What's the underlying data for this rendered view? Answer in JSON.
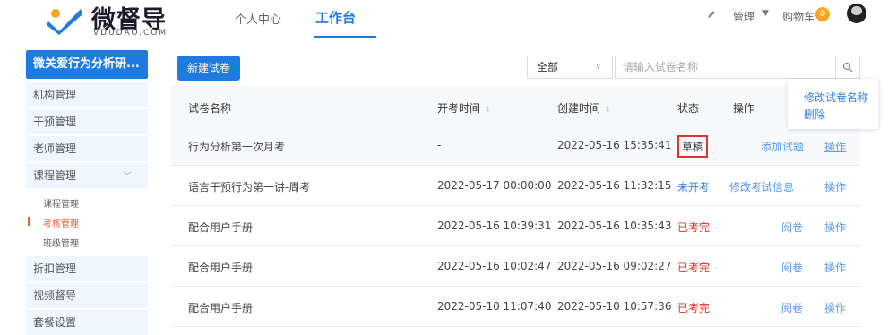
{
  "brand": {
    "name": "微督导",
    "sub": "VDUDAO.COM"
  },
  "nav": {
    "personal": "个人中心",
    "workbench": "工作台"
  },
  "header_right": {
    "manage": "管理",
    "cart": "购物车",
    "cart_count": "0"
  },
  "sidebar": {
    "org": "微关爱行为分析研...",
    "items": [
      "机构管理",
      "干预管理",
      "老师管理",
      "课程管理"
    ],
    "subitems": [
      "课程管理",
      "考核管理",
      "班级管理"
    ],
    "items2": [
      "折扣管理",
      "视频督导",
      "套餐设置"
    ]
  },
  "toolbar": {
    "new_button": "新建试卷",
    "filter_value": "全部",
    "search_placeholder": "请输入试卷名称"
  },
  "table": {
    "headers": {
      "name": "试卷名称",
      "start": "开考时间",
      "created": "创建时间",
      "status": "状态",
      "action": "操作"
    },
    "rows": [
      {
        "name": "行为分析第一次月考",
        "start": "-",
        "created": "2022-05-16 15:35:41",
        "status": "草稿",
        "action1": "添加试题",
        "action2": "操作"
      },
      {
        "name": "语言干预行为第一讲-周考",
        "start": "2022-05-17 00:00:00",
        "created": "2022-05-16 11:32:15",
        "status": "未开考",
        "action1": "修改考试信息",
        "action2": "操作"
      },
      {
        "name": "配合用户手册",
        "start": "2022-05-16 10:39:31",
        "created": "2022-05-16 10:35:43",
        "status": "已考完",
        "action1": "阅卷",
        "action2": "操作"
      },
      {
        "name": "配合用户手册",
        "start": "2022-05-16 10:02:47",
        "created": "2022-05-16 09:02:27",
        "status": "已考完",
        "action1": "阅卷",
        "action2": "操作"
      },
      {
        "name": "配合用户手册",
        "start": "2022-05-10 11:07:40",
        "created": "2022-05-10 10:57:36",
        "status": "已考完",
        "action1": "阅卷",
        "action2": "操作"
      }
    ]
  },
  "popover": {
    "rename": "修改试卷名称",
    "delete": "删除"
  },
  "colors": {
    "primary": "#1f7be0",
    "danger": "#e0322c",
    "link": "#5a9be6",
    "accent": "#e8603c"
  }
}
